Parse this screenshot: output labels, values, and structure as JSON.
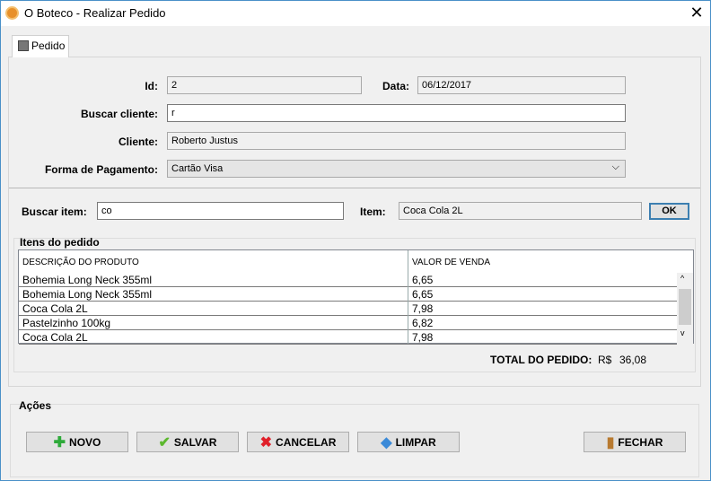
{
  "window": {
    "title": "O Boteco - Realizar Pedido",
    "close": "✕"
  },
  "tab": {
    "label": "Pedido"
  },
  "form": {
    "id_label": "Id:",
    "id_value": "2",
    "data_label": "Data:",
    "data_value": "06/12/2017",
    "buscar_cliente_label": "Buscar cliente:",
    "buscar_cliente_value": "r",
    "cliente_label": "Cliente:",
    "cliente_value": "Roberto Justus",
    "pagamento_label": "Forma de Pagamento:",
    "pagamento_value": "Cartão Visa",
    "buscar_item_label": "Buscar item:",
    "buscar_item_value": "co",
    "item_label": "Item:",
    "item_value": "Coca Cola 2L",
    "ok_label": "OK"
  },
  "items": {
    "group_label": "Itens do pedido",
    "columns": [
      "DESCRIÇÃO DO PRODUTO",
      "VALOR DE VENDA"
    ],
    "rows": [
      [
        "Bohemia Long Neck 355ml",
        "6,65"
      ],
      [
        "Bohemia Long Neck 355ml",
        "6,65"
      ],
      [
        "Coca Cola 2L",
        "7,98"
      ],
      [
        "Pastelzinho 100kg",
        "6,82"
      ],
      [
        "Coca Cola 2L",
        "7,98"
      ]
    ],
    "total_label": "TOTAL DO PEDIDO:",
    "currency": "R$",
    "total_value": "36,08"
  },
  "actions": {
    "group_label": "Ações",
    "novo": "NOVO",
    "salvar": "SALVAR",
    "cancelar": "CANCELAR",
    "limpar": "LIMPAR",
    "fechar": "FECHAR"
  }
}
